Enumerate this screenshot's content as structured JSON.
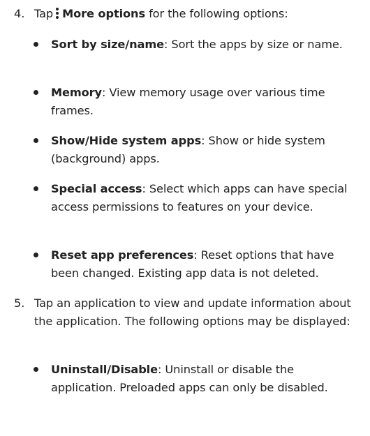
{
  "step4": {
    "number": "4.",
    "text_before": "Tap",
    "icon": "more-options-vertical-dots-icon",
    "bold": "More options",
    "text_after": "for the following options:"
  },
  "step4_items": [
    {
      "term": "Sort by size/name",
      "desc": ": Sort the apps by size or name."
    },
    {
      "term": "Memory",
      "desc": ": View memory usage over various time frames."
    },
    {
      "term": "Show/Hide system apps",
      "desc": ": Show or hide system (background) apps."
    },
    {
      "term": "Special access",
      "desc": ": Select which apps can have special access permissions to features on your device."
    },
    {
      "term": "Reset app preferences",
      "desc": ": Reset options that have been changed. Existing app data is not deleted."
    }
  ],
  "step5": {
    "number": "5.",
    "text": "Tap an application to view and update information about the application. The following options may be displayed:"
  },
  "step5_items": [
    {
      "term": "Uninstall/Disable",
      "desc": ": Uninstall or disable the application. Preloaded apps can only be disabled."
    }
  ]
}
